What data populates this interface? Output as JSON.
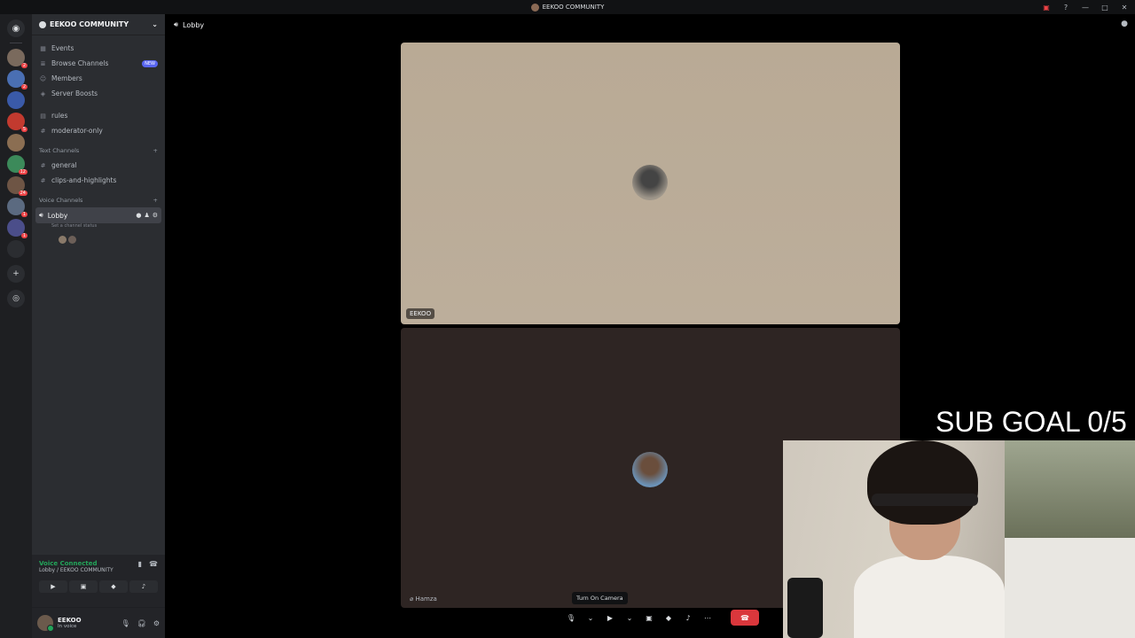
{
  "window": {
    "title": "EEKOO COMMUNITY"
  },
  "rail": {
    "servers": [
      {
        "color": "#7a6a5d",
        "badge": "2"
      },
      {
        "color": "#4a6fb3",
        "badge": "2"
      },
      {
        "color": "#3a5aa8",
        "badge": ""
      },
      {
        "color": "#c23a2f",
        "badge": "5"
      },
      {
        "color": "#8b6e52",
        "badge": ""
      },
      {
        "color": "#3c8a5a",
        "badge": "12"
      },
      {
        "color": "#6e5545",
        "badge": "24"
      },
      {
        "color": "#5b6a80",
        "badge": "1"
      },
      {
        "color": "#4b4e8a",
        "badge": "1"
      },
      {
        "color": "#2b2d31",
        "badge": ""
      }
    ]
  },
  "sidebar": {
    "server_name": "EEKOO COMMUNITY",
    "nav": [
      {
        "label": "Events"
      },
      {
        "label": "Browse Channels",
        "badge": "NEW"
      },
      {
        "label": "Members"
      },
      {
        "label": "Server Boosts"
      }
    ],
    "top_channels": [
      {
        "label": "rules"
      },
      {
        "label": "moderator-only"
      }
    ],
    "text_category": "Text Channels",
    "text_channels": [
      {
        "label": "general"
      },
      {
        "label": "clips-and-highlights"
      }
    ],
    "voice_category": "Voice Channels",
    "voice_channel": "Lobby",
    "channel_status": "Set a channel status"
  },
  "voice_panel": {
    "status": "Voice Connected",
    "location": "Lobby / EEKOO COMMUNITY"
  },
  "user": {
    "name": "EEKOO",
    "status": "In voice"
  },
  "main": {
    "channel": "Lobby",
    "tiles": [
      {
        "name": "EEKOO"
      },
      {
        "name": "Hamza"
      }
    ],
    "tooltip": "Turn On Camera"
  },
  "overlay": {
    "sub_goal": "SUB GOAL 0/5"
  }
}
